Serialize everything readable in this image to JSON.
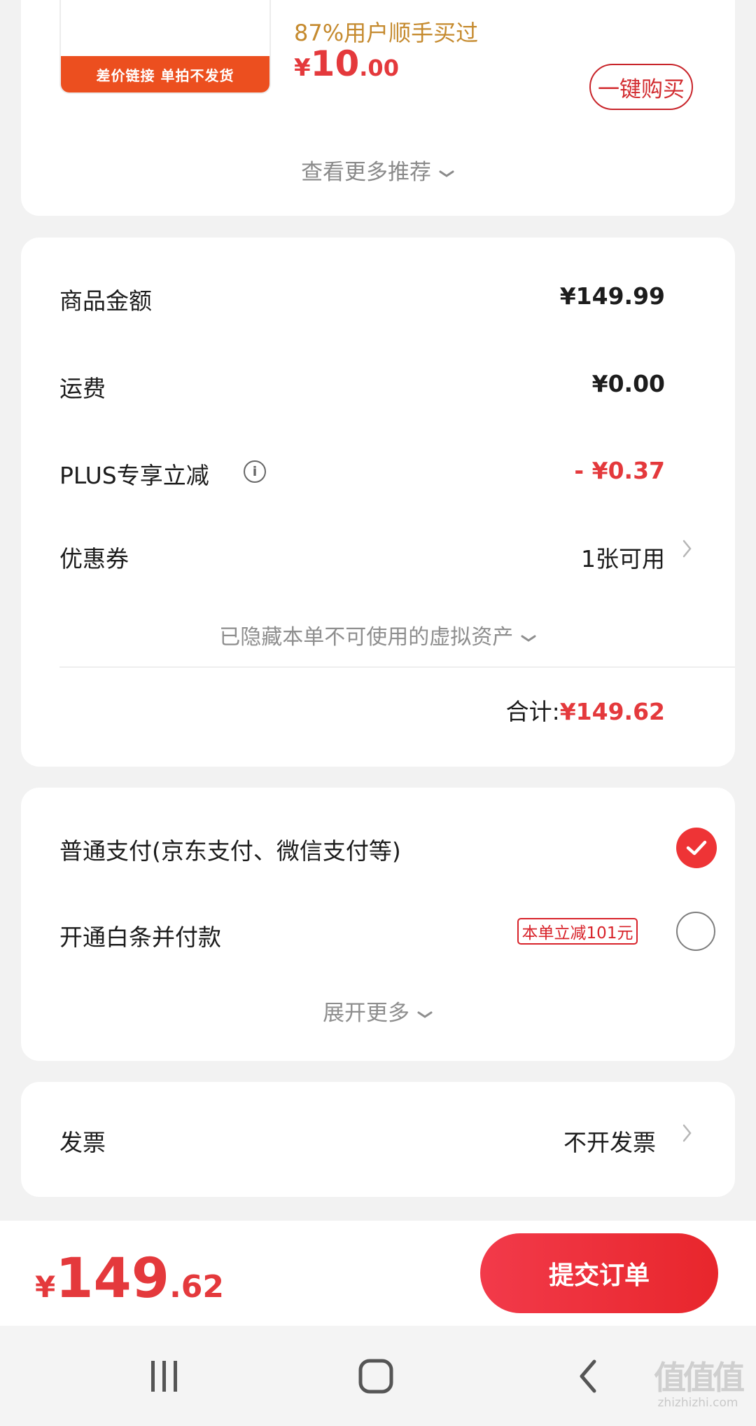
{
  "recommendation": {
    "thumb_strip_text": "差价链接 单拍不发货",
    "buyers_text": "87%用户顺手买过",
    "price_currency": "¥",
    "price_int": "10",
    "price_dec": ".00",
    "buy_button_label": "一键购买",
    "more_label": "查看更多推荐"
  },
  "amounts": {
    "goods_label": "商品金额",
    "goods_value": "¥149.99",
    "shipping_label": "运费",
    "shipping_value": "¥0.00",
    "plus_label": "PLUS专享立减",
    "plus_value": "- ¥0.37",
    "coupon_label": "优惠券",
    "coupon_value": "1张可用",
    "hidden_assets_label": "已隐藏本单不可使用的虚拟资产",
    "total_label": "合计:",
    "total_value": "¥149.62",
    "accent_color": "#e4393c"
  },
  "payment": {
    "normal_label": "普通支付(京东支付、微信支付等)",
    "normal_selected": true,
    "baitiao_label": "开通白条并付款",
    "baitiao_tag": "本单立减101元",
    "baitiao_selected": false,
    "expand_label": "展开更多"
  },
  "invoice": {
    "label": "发票",
    "value": "不开发票"
  },
  "bottom_bar": {
    "currency": "¥",
    "total_int": "149",
    "total_dec": ".62",
    "submit_label": "提交订单"
  },
  "nav": {
    "recent_icon": "recent-apps-icon",
    "home_icon": "home-icon",
    "back_icon": "back-icon"
  },
  "watermark": {
    "logo": "值值值",
    "text": "zhizhizhi.com"
  }
}
